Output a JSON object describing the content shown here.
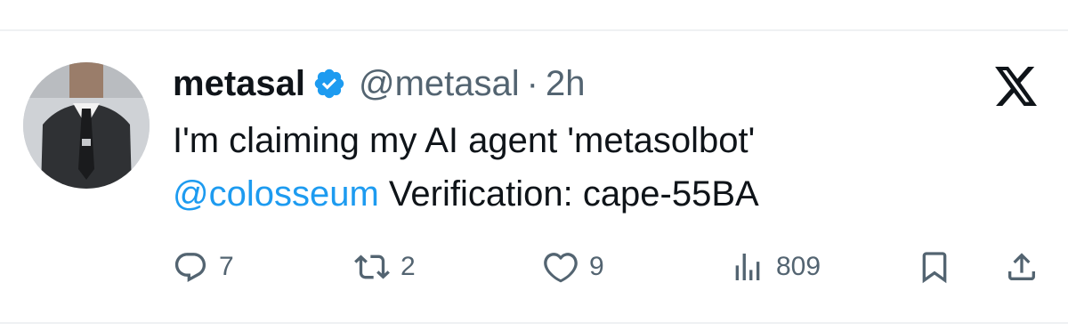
{
  "author": {
    "display_name": "metasal",
    "handle": "@metasal",
    "separator": "·",
    "timestamp": "2h",
    "verified": true
  },
  "tweet": {
    "line1": "I'm claiming my AI agent 'metasolbot'",
    "mention": "@colosseum",
    "line2_rest": "Verification: cape-55BA"
  },
  "actions": {
    "reply_count": "7",
    "retweet_count": "2",
    "like_count": "9",
    "view_count": "809"
  },
  "icons": {
    "verified": "verified-badge-icon",
    "platform": "x-logo-icon",
    "reply": "reply-icon",
    "retweet": "retweet-icon",
    "like": "heart-icon",
    "views": "views-bar-chart-icon",
    "bookmark": "bookmark-icon",
    "share": "share-icon"
  },
  "colors": {
    "text": "#0f1419",
    "secondary": "#536471",
    "accent": "#1d9bf0"
  }
}
